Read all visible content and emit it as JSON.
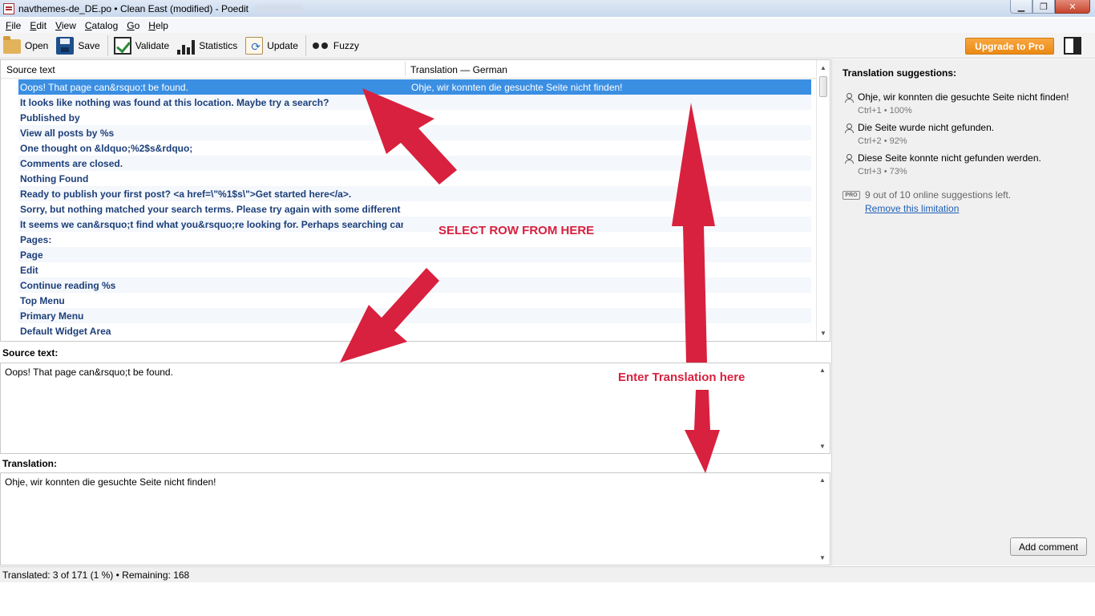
{
  "window": {
    "title": "navthemes-de_DE.po • Clean East (modified) - Poedit",
    "minimize": "▁",
    "maximize": "❐",
    "close": "✕"
  },
  "menu": [
    "File",
    "Edit",
    "View",
    "Catalog",
    "Go",
    "Help"
  ],
  "toolbar": {
    "open": "Open",
    "save": "Save",
    "validate": "Validate",
    "statistics": "Statistics",
    "update": "Update",
    "fuzzy": "Fuzzy",
    "upgrade": "Upgrade to Pro"
  },
  "list": {
    "col_source": "Source text",
    "col_translation": "Translation — German",
    "rows": [
      {
        "source": "Oops! That page can&rsquo;t be found.",
        "translation": "Ohje, wir konnten die gesuchte Seite nicht finden!"
      },
      {
        "source": "It looks like nothing was found at this location. Maybe try a search?",
        "translation": ""
      },
      {
        "source": "Published by",
        "translation": ""
      },
      {
        "source": "View all posts by %s",
        "translation": ""
      },
      {
        "source": "One thought on &ldquo;%2$s&rdquo;",
        "translation": ""
      },
      {
        "source": "Comments are closed.",
        "translation": ""
      },
      {
        "source": "Nothing Found",
        "translation": ""
      },
      {
        "source": "Ready to publish your first post? <a href=\\\"%1$s\\\">Get started here</a>.",
        "translation": ""
      },
      {
        "source": "Sorry, but nothing matched your search terms. Please try again with some different ...",
        "translation": ""
      },
      {
        "source": "It seems we can&rsquo;t find what you&rsquo;re looking for. Perhaps searching can ...",
        "translation": ""
      },
      {
        "source": "Pages:",
        "translation": ""
      },
      {
        "source": "Page",
        "translation": ""
      },
      {
        "source": "Edit",
        "translation": ""
      },
      {
        "source": "Continue reading %s",
        "translation": ""
      },
      {
        "source": "Top Menu",
        "translation": ""
      },
      {
        "source": "Primary Menu",
        "translation": ""
      },
      {
        "source": "Default Widget Area",
        "translation": ""
      }
    ]
  },
  "editor": {
    "source_label": "Source text:",
    "source_value": "Oops! That page can&rsquo;t be found.",
    "translation_label": "Translation:",
    "translation_value": "Ohje, wir konnten die gesuchte Seite nicht finden!"
  },
  "sidebar": {
    "title": "Translation suggestions:",
    "suggestions": [
      {
        "text": "Ohje, wir konnten die gesuchte Seite nicht finden!",
        "meta": "Ctrl+1 • 100%"
      },
      {
        "text": "Die Seite wurde nicht gefunden.",
        "meta": "Ctrl+2 • 92%"
      },
      {
        "text": "Diese Seite konnte nicht gefunden werden.",
        "meta": "Ctrl+3 • 73%"
      }
    ],
    "pro_badge": "PRO",
    "suggestions_left": "9 out of 10 online suggestions left.",
    "remove_limitation": "Remove this limitation",
    "add_comment": "Add comment"
  },
  "status": {
    "text": "Translated: 3 of 171 (1 %)  •  Remaining: 168"
  },
  "annotations": {
    "select_row": "SELECT  ROW FROM HERE",
    "enter_translation": "Enter Translation here",
    "color": "#d8213e"
  },
  "colors": {
    "selection": "#3b8fe3",
    "source_text": "#1c3f7a",
    "upgrade": "#f19a2a"
  }
}
